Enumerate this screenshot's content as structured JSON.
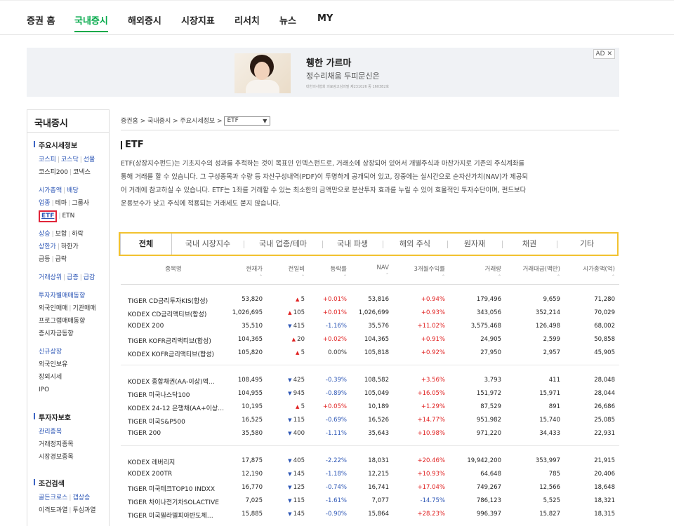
{
  "nav": {
    "items": [
      "증권 홈",
      "국내증시",
      "해외증시",
      "시장지표",
      "리서치",
      "뉴스",
      "MY"
    ],
    "active_index": 1
  },
  "ad": {
    "title": "휑한 가르마",
    "subtitle": "정수리채움 두피문신은",
    "fineprint": "대한의사협회 의료광고심의필 제231026 중 160382호",
    "badge": "AD ✕"
  },
  "sidebar": {
    "title": "국내증시",
    "sections": [
      {
        "head": "주요시세정보",
        "rows": [
          {
            "items": [
              "코스피",
              "코스닥",
              "선물"
            ],
            "color": "blue"
          },
          {
            "items": [
              "코스피200",
              "코넥스"
            ],
            "color": "dark"
          },
          {
            "spacer": true
          },
          {
            "items": [
              "시가총액",
              "배당"
            ],
            "color": "blue"
          },
          {
            "items": [
              "업종",
              "테마",
              "그룹사"
            ],
            "color": "mixed"
          },
          {
            "items": [
              "ETF",
              "ETN"
            ],
            "color": "etf"
          },
          {
            "spacer": true
          },
          {
            "items": [
              "상승",
              "보합",
              "하락"
            ],
            "color": "mixed"
          },
          {
            "items": [
              "상한가",
              "하한가"
            ],
            "color": "mixed"
          },
          {
            "items": [
              "급등",
              "급락"
            ],
            "color": "dark"
          },
          {
            "spacer": true
          },
          {
            "items": [
              "거래상위",
              "급증",
              "급감"
            ],
            "color": "blue"
          },
          {
            "spacer": true
          },
          {
            "items": [
              "투자자별매매동향"
            ],
            "color": "blue"
          },
          {
            "items": [
              "외국인매매",
              "기관매매"
            ],
            "color": "dark"
          },
          {
            "items": [
              "프로그램매매동향"
            ],
            "color": "dark"
          },
          {
            "items": [
              "증시자금동향"
            ],
            "color": "dark"
          },
          {
            "spacer": true
          },
          {
            "items": [
              "신규상장"
            ],
            "color": "blue"
          },
          {
            "items": [
              "외국인보유"
            ],
            "color": "dark"
          },
          {
            "items": [
              "장외시세"
            ],
            "color": "dark"
          },
          {
            "items": [
              "IPO"
            ],
            "color": "dark"
          }
        ]
      },
      {
        "head": "투자자보호",
        "rows": [
          {
            "items": [
              "관리종목"
            ],
            "color": "blue"
          },
          {
            "items": [
              "거래정지종목"
            ],
            "color": "dark"
          },
          {
            "items": [
              "시장경보종목"
            ],
            "color": "dark"
          }
        ]
      },
      {
        "head": "조건검색",
        "rows": [
          {
            "items": [
              "골든크로스",
              "갭상승"
            ],
            "color": "blue"
          },
          {
            "items": [
              "이격도과열",
              "투심과열"
            ],
            "color": "dark"
          }
        ]
      }
    ]
  },
  "breadcrumb": {
    "path": "증권홈 > 국내증시 > 주요시세정보 >",
    "select_value": "ETF"
  },
  "page_title": "ETF",
  "description": [
    "ETF(상장지수펀드)는 기초지수의 성과를 추적하는 것이 목표인 인덱스펀드로, 거래소에 상장되어 있어서 개별주식과 마찬가지로 기존의 주식계좌를",
    "통해 거래를 할 수 있습니다. 그 구성종목과 수량 등 자산구성내역(PDF)이 투명하게 공개되어 있고, 장중에는 실시간으로 순자산가치(NAV)가 제공되",
    "어 거래에 참고하실 수 있습니다. ETF는 1좌를 거래할 수 있는 최소한의 금액만으로 분산투자 효과를 누릴 수 있어 효율적인 투자수단이며, 펀드보다",
    "운용보수가 낮고 주식에 적용되는 거래세도 붙지 않습니다."
  ],
  "tabs": [
    "전체",
    "국내 시장지수",
    "국내 업종/테마",
    "국내 파생",
    "해외 주식",
    "원자재",
    "채권",
    "기타"
  ],
  "active_tab": 0,
  "columns": [
    "종목명",
    "현재가",
    "전일비",
    "등락률",
    "NAV",
    "3개월수익률",
    "거래량",
    "거래대금(백만)",
    "시가총액(억)"
  ],
  "groups": [
    [
      {
        "name": "TIGER CD금리투자KIS(합성)",
        "price": "53,820",
        "dir": "up",
        "change": "5",
        "rate": "+0.01%",
        "nav": "53,816",
        "ret3m": "+0.94%",
        "volume": "179,496",
        "amount": "9,659",
        "mcap": "71,280"
      },
      {
        "name": "KODEX CD금리액티브(합성)",
        "price": "1,026,695",
        "dir": "up",
        "change": "105",
        "rate": "+0.01%",
        "nav": "1,026,699",
        "ret3m": "+0.93%",
        "volume": "343,056",
        "amount": "352,214",
        "mcap": "70,029"
      },
      {
        "name": "KODEX 200",
        "price": "35,510",
        "dir": "down",
        "change": "415",
        "rate": "-1.16%",
        "nav": "35,576",
        "ret3m": "+11.02%",
        "volume": "3,575,468",
        "amount": "126,498",
        "mcap": "68,002"
      },
      {
        "name": "TIGER KOFR금리액티브(합성)",
        "price": "104,365",
        "dir": "up",
        "change": "20",
        "rate": "+0.02%",
        "nav": "104,365",
        "ret3m": "+0.91%",
        "volume": "24,905",
        "amount": "2,599",
        "mcap": "50,858"
      },
      {
        "name": "KODEX KOFR금리액티브(합성)",
        "price": "105,820",
        "dir": "up",
        "change": "5",
        "rate": "0.00%",
        "nav": "105,818",
        "ret3m": "+0.92%",
        "volume": "27,950",
        "amount": "2,957",
        "mcap": "45,905"
      }
    ],
    [
      {
        "name": "KODEX 종합채권(AA-이상)액…",
        "price": "108,495",
        "dir": "down",
        "change": "425",
        "rate": "-0.39%",
        "nav": "108,582",
        "ret3m": "+3.56%",
        "volume": "3,793",
        "amount": "411",
        "mcap": "28,048"
      },
      {
        "name": "TIGER 미국나스닥100",
        "price": "104,955",
        "dir": "down",
        "change": "945",
        "rate": "-0.89%",
        "nav": "105,049",
        "ret3m": "+16.05%",
        "volume": "151,972",
        "amount": "15,971",
        "mcap": "28,044"
      },
      {
        "name": "KODEX 24-12 은행채(AA+이상…",
        "price": "10,195",
        "dir": "up",
        "change": "5",
        "rate": "+0.05%",
        "nav": "10,189",
        "ret3m": "+1.29%",
        "volume": "87,529",
        "amount": "891",
        "mcap": "26,686"
      },
      {
        "name": "TIGER 미국S&P500",
        "price": "16,525",
        "dir": "down",
        "change": "115",
        "rate": "-0.69%",
        "nav": "16,526",
        "ret3m": "+14.77%",
        "volume": "951,982",
        "amount": "15,740",
        "mcap": "25,085"
      },
      {
        "name": "TIGER 200",
        "price": "35,580",
        "dir": "down",
        "change": "400",
        "rate": "-1.11%",
        "nav": "35,643",
        "ret3m": "+10.98%",
        "volume": "971,220",
        "amount": "34,433",
        "mcap": "22,931"
      }
    ],
    [
      {
        "name": "KODEX 레버리지",
        "price": "17,875",
        "dir": "down",
        "change": "405",
        "rate": "-2.22%",
        "nav": "18,031",
        "ret3m": "+20.46%",
        "volume": "19,942,200",
        "amount": "353,997",
        "mcap": "21,915"
      },
      {
        "name": "KODEX 200TR",
        "price": "12,190",
        "dir": "down",
        "change": "145",
        "rate": "-1.18%",
        "nav": "12,215",
        "ret3m": "+10.93%",
        "volume": "64,648",
        "amount": "785",
        "mcap": "20,406"
      },
      {
        "name": "TIGER 미국테크TOP10 INDXX",
        "price": "16,770",
        "dir": "down",
        "change": "125",
        "rate": "-0.74%",
        "nav": "16,741",
        "ret3m": "+17.04%",
        "volume": "749,267",
        "amount": "12,566",
        "mcap": "18,648"
      },
      {
        "name": "TIGER 차이나전기차SOLACTIVE",
        "price": "7,025",
        "dir": "down",
        "change": "115",
        "rate": "-1.61%",
        "nav": "7,077",
        "ret3m": "-14.75%",
        "volume": "786,123",
        "amount": "5,525",
        "mcap": "18,321"
      },
      {
        "name": "TIGER 미국필라델피아반도체…",
        "price": "15,885",
        "dir": "down",
        "change": "145",
        "rate": "-0.90%",
        "nav": "15,864",
        "ret3m": "+28.23%",
        "volume": "996,397",
        "amount": "15,827",
        "mcap": "18,315"
      }
    ]
  ]
}
